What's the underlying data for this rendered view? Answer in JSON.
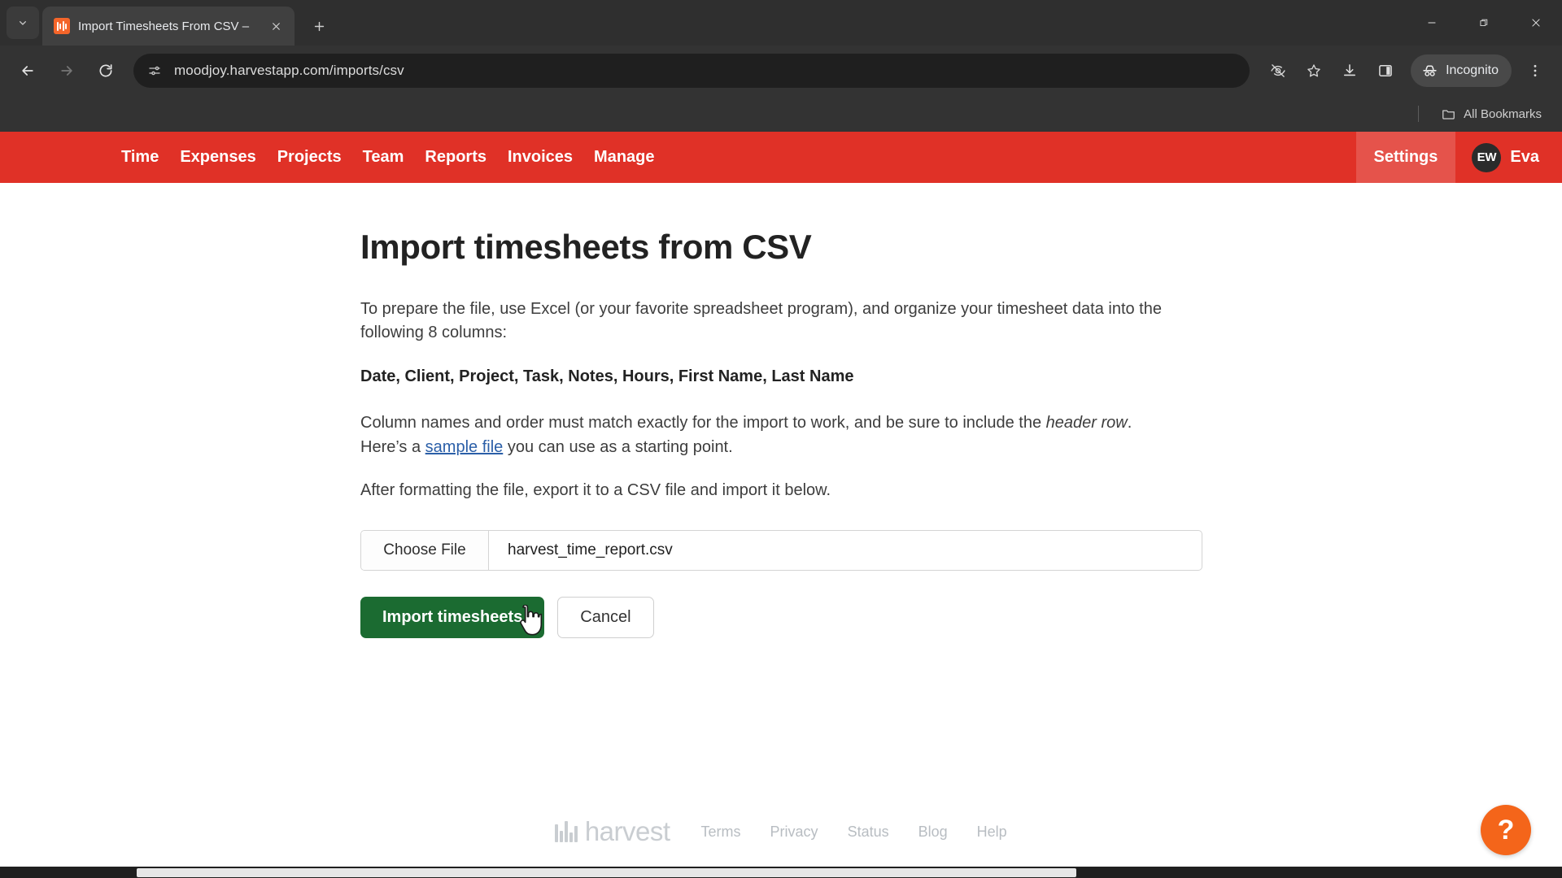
{
  "browser": {
    "tab": {
      "title": "Import Timesheets From CSV –",
      "favicon": "harvest-logo-icon",
      "close_icon": "close-icon",
      "search_icon": "tab-search-chevron-icon",
      "new_tab_icon": "plus-icon"
    },
    "window_controls": {
      "minimize": "minimize-icon",
      "restore": "restore-icon",
      "close": "close-icon"
    },
    "toolbar": {
      "back_icon": "arrow-left-icon",
      "forward_icon": "arrow-right-icon",
      "reload_icon": "reload-icon",
      "url": "moodjoy.harvestapp.com/imports/csv",
      "site_info_icon": "tune-settings-icon",
      "tracking_icon": "eye-slash-icon",
      "bookmark_icon": "star-icon",
      "download_icon": "download-icon",
      "sidepanel_icon": "side-panel-icon",
      "incognito_label": "Incognito",
      "incognito_icon": "incognito-hat-icon",
      "menu_icon": "three-dots-vertical-icon"
    },
    "bookmarks_bar": {
      "all_bookmarks_label": "All Bookmarks",
      "folder_icon": "folder-icon"
    }
  },
  "app": {
    "nav": {
      "items": [
        {
          "label": "Time"
        },
        {
          "label": "Expenses"
        },
        {
          "label": "Projects"
        },
        {
          "label": "Team"
        },
        {
          "label": "Reports"
        },
        {
          "label": "Invoices"
        },
        {
          "label": "Manage"
        }
      ],
      "settings_label": "Settings",
      "avatar_initials": "EW",
      "user_name": "Eva",
      "bar_color": "#e03127"
    },
    "main": {
      "title": "Import timesheets from CSV",
      "para1_a": "To prepare the file, use Excel (or your favorite spreadsheet program), and organize your timesheet data into the following 8 columns:",
      "columns_line": "Date, Client, Project, Task, Notes, Hours, First Name, Last Name",
      "para2_a": "Column names and order must match exactly for the import to work, and be sure to include the ",
      "para2_em": "header row",
      "para2_b": ". Here’s a ",
      "para2_link": "sample file",
      "para2_c": " you can use as a starting point.",
      "para3": "After formatting the file, export it to a CSV file and import it below.",
      "file_button_label": "Choose File",
      "file_name": "harvest_time_report.csv",
      "submit_label": "Import timesheets",
      "cancel_label": "Cancel",
      "primary_color": "#1b6b31"
    },
    "footer": {
      "wordmark": "harvest",
      "links": [
        {
          "label": "Terms"
        },
        {
          "label": "Privacy"
        },
        {
          "label": "Status"
        },
        {
          "label": "Blog"
        },
        {
          "label": "Help"
        }
      ]
    },
    "help_fab": {
      "glyph": "?",
      "color": "#f4651a"
    }
  }
}
